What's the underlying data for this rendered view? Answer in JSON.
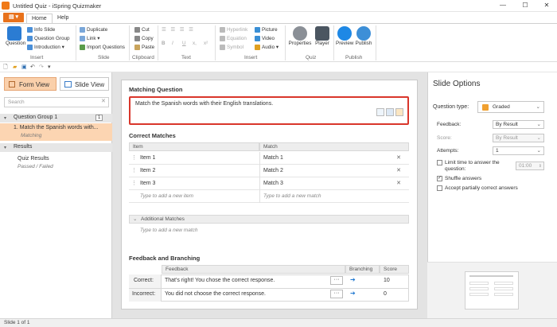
{
  "window": {
    "title": "Untitled Quiz - iSpring Quizmaker",
    "minimize": "—",
    "maximize": "☐",
    "close": "✕"
  },
  "ribbon": {
    "file_label": "▤ ▾",
    "tabs": [
      "Home",
      "Help"
    ],
    "insert": {
      "question": "Question",
      "info_slide": "Info Slide",
      "question_group": "Question Group",
      "introduction": "Introduction ▾",
      "label": "Insert"
    },
    "slide": {
      "duplicate": "Duplicate",
      "link": "Link ▾",
      "import_questions": "Import Questions",
      "label": "Slide"
    },
    "clipboard": {
      "cut": "Cut",
      "copy": "Copy",
      "paste": "Paste",
      "label": "Clipboard"
    },
    "text": {
      "label": "Text",
      "bold": "B",
      "italic": "I",
      "underline": "U",
      "sub": "x,",
      "sup": "x²"
    },
    "insert2": {
      "hyperlink": "Hyperlink",
      "equation": "Equation",
      "symbol": "Symbol",
      "picture": "Picture",
      "video": "Video",
      "audio": "Audio ▾",
      "label": "Insert"
    },
    "quiz": {
      "properties": "Properties",
      "player": "Player",
      "label": "Quiz"
    },
    "publish": {
      "preview": "Preview",
      "publish": "Publish",
      "label": "Publish"
    }
  },
  "left": {
    "form_view": "Form View",
    "slide_view": "Slide View",
    "search_placeholder": "Search",
    "group": "Question Group 1",
    "group_count": "1",
    "item_title": "1. Match the Spanish words with...",
    "item_type": "Matching",
    "results": "Results",
    "quiz_results": "Quiz Results",
    "quiz_results_sub": "Passed / Failed"
  },
  "main": {
    "question_heading": "Matching Question",
    "question_text": "Match the Spanish words with their English translations.",
    "correct_matches_heading": "Correct Matches",
    "col_item": "Item",
    "col_match": "Match",
    "rows": [
      {
        "item": "Item 1",
        "match": "Match 1"
      },
      {
        "item": "Item 2",
        "match": "Match 2"
      },
      {
        "item": "Item 3",
        "match": "Match 3"
      }
    ],
    "new_item_placeholder": "Type to add a new item",
    "new_match_placeholder": "Type to add a new match",
    "additional_heading": "Additional Matches",
    "additional_placeholder": "Type to add a new match",
    "feedback_heading": "Feedback and Branching",
    "fb_col_feedback": "Feedback",
    "fb_col_branching": "Branching",
    "fb_col_score": "Score",
    "correct_label": "Correct:",
    "correct_text": "That's right! You chose the correct response.",
    "correct_score": "10",
    "incorrect_label": "Incorrect:",
    "incorrect_text": "You did not choose the correct response.",
    "incorrect_score": "0"
  },
  "options": {
    "title": "Slide Options",
    "question_type_label": "Question type:",
    "question_type": "Graded",
    "feedback_label": "Feedback:",
    "feedback_value": "By Result",
    "score_label": "Score:",
    "score_value": "By Result",
    "attempts_label": "Attempts:",
    "attempts_value": "1",
    "limit_time": "Limit time to answer the question:",
    "time_value": "01:00",
    "shuffle": "Shuffle answers",
    "partial": "Accept partially correct answers"
  },
  "status": "Slide 1 of 1"
}
